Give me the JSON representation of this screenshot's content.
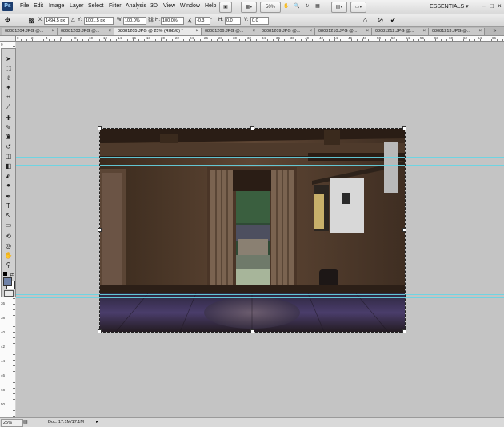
{
  "app": {
    "logo": "Ps",
    "menus": [
      "File",
      "Edit",
      "Image",
      "Layer",
      "Select",
      "Filter",
      "Analysis",
      "3D",
      "View",
      "Window",
      "Help"
    ],
    "zoom_label": "50%",
    "workspace": "ESSENTIALS",
    "window_controls": [
      "–",
      "□",
      "×"
    ]
  },
  "options": {
    "x_label": "X:",
    "x_value": "1494.5 px",
    "y_label": "Y:",
    "y_value": "1001.5 px",
    "w_label": "W:",
    "w_value": "100.0%",
    "h_label": "H:",
    "h_value": "100.0%",
    "angle_value": "-0.3",
    "h_skew_label": "H:",
    "h_skew_value": "0.0",
    "v_skew_label": "V:",
    "v_skew_value": "0.0"
  },
  "tabs": [
    {
      "label": "08081204.JPG @...",
      "close": "×"
    },
    {
      "label": "08081203.JPG @...",
      "close": "×"
    },
    {
      "label": "08081205.JPG @ 25% (RGB/8) *",
      "close": "×",
      "active": true
    },
    {
      "label": "08081206.JPG @...",
      "close": "×"
    },
    {
      "label": "08081209.JPG @...",
      "close": "×"
    },
    {
      "label": "08081210.JPG @...",
      "close": "×"
    },
    {
      "label": "08081212.JPG @...",
      "close": "×"
    },
    {
      "label": "08081213.JPG @...",
      "close": "×"
    }
  ],
  "ruler_top": [
    "0",
    "2",
    "4",
    "6",
    "8",
    "10",
    "12",
    "14",
    "16",
    "18",
    "20",
    "22",
    "24",
    "26",
    "28",
    "30",
    "32",
    "34",
    "36",
    "38",
    "40",
    "42",
    "44",
    "46",
    "48",
    "50",
    "52",
    "54",
    "56",
    "58",
    "60",
    "62",
    "64",
    "66"
  ],
  "ruler_left": [
    "0",
    "2",
    "4",
    "6",
    "8",
    "10",
    "12",
    "14",
    "16",
    "18",
    "20",
    "22",
    "24",
    "26",
    "28",
    "30",
    "32",
    "34",
    "36",
    "38",
    "40",
    "42",
    "44",
    "46",
    "48",
    "50",
    "52"
  ],
  "status": {
    "zoom": "25%",
    "doc": "Doc: 17.1M/17.1M"
  }
}
